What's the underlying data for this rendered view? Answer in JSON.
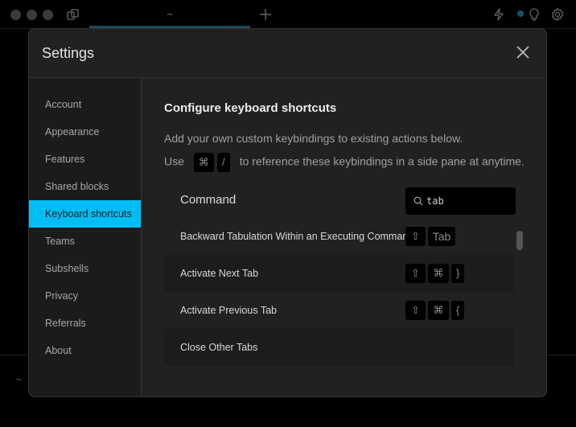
{
  "window": {
    "tab_title": "~",
    "prompt_symbol": "~",
    "accent_color": "#00bef5"
  },
  "settings": {
    "title": "Settings",
    "close_icon": "close-icon",
    "sidebar": {
      "items": [
        {
          "label": "Account",
          "active": false
        },
        {
          "label": "Appearance",
          "active": false
        },
        {
          "label": "Features",
          "active": false
        },
        {
          "label": "Shared blocks",
          "active": false
        },
        {
          "label": "Keyboard shortcuts",
          "active": true
        },
        {
          "label": "Teams",
          "active": false
        },
        {
          "label": "Subshells",
          "active": false
        },
        {
          "label": "Privacy",
          "active": false
        },
        {
          "label": "Referrals",
          "active": false
        },
        {
          "label": "About",
          "active": false
        }
      ]
    },
    "content": {
      "heading": "Configure keyboard shortcuts",
      "description": "Add your own custom keybindings to existing actions below.",
      "hint_prefix": "Use",
      "hint_keys": [
        "⌘",
        "/"
      ],
      "hint_suffix": "to reference these keybindings in a side pane at anytime.",
      "column_header": "Command",
      "search": {
        "value": "tab",
        "placeholder": ""
      },
      "shortcuts": [
        {
          "command": "Backward Tabulation Within an Executing Command",
          "keys": [
            "⇧",
            "Tab"
          ]
        },
        {
          "command": "Activate Next Tab",
          "keys": [
            "⇧",
            "⌘",
            "}"
          ]
        },
        {
          "command": "Activate Previous Tab",
          "keys": [
            "⇧",
            "⌘",
            "{"
          ]
        },
        {
          "command": "Close Other Tabs",
          "keys": []
        }
      ]
    }
  }
}
